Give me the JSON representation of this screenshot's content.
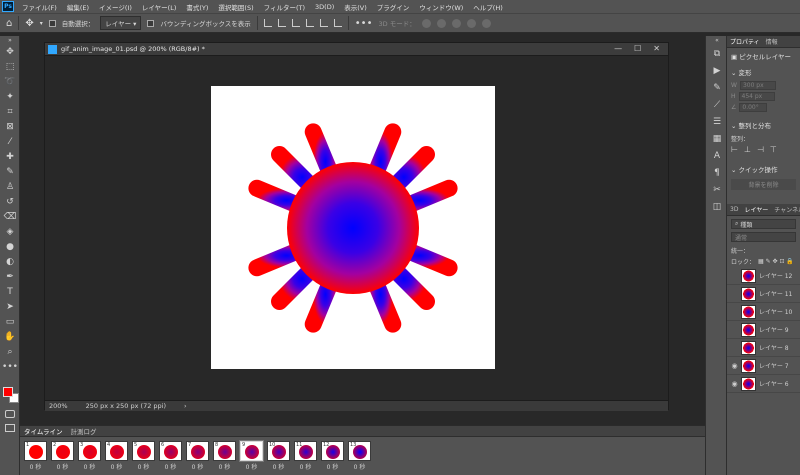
{
  "menubar": {
    "logo": "Ps",
    "items": [
      "ファイル(F)",
      "編集(E)",
      "イメージ(I)",
      "レイヤー(L)",
      "書式(Y)",
      "選択範囲(S)",
      "フィルター(T)",
      "3D(D)",
      "表示(V)",
      "プラグイン",
      "ウィンドウ(W)",
      "ヘルプ(H)"
    ]
  },
  "options": {
    "auto_select_label": "自動選択：",
    "auto_select_value": "レイヤー",
    "bbox_label": "バウンディングボックスを表示",
    "mode_3d_label": "3D モード："
  },
  "document": {
    "title": "gif_anim_image_01.psd @ 200% (RGB/8#) *",
    "zoom": "200%",
    "size_info": "250 px x 250 px (72 ppi)"
  },
  "timeline": {
    "tabs": [
      "タイムライン",
      "計測ログ"
    ],
    "frames": [
      {
        "num": "1",
        "delay": "0 秒"
      },
      {
        "num": "2",
        "delay": "0 秒"
      },
      {
        "num": "3",
        "delay": "0 秒"
      },
      {
        "num": "4",
        "delay": "0 秒"
      },
      {
        "num": "5",
        "delay": "0 秒"
      },
      {
        "num": "6",
        "delay": "0 秒"
      },
      {
        "num": "7",
        "delay": "0 秒"
      },
      {
        "num": "8",
        "delay": "0 秒"
      },
      {
        "num": "9",
        "delay": "0 秒"
      },
      {
        "num": "10",
        "delay": "0 秒"
      },
      {
        "num": "11",
        "delay": "0 秒"
      },
      {
        "num": "12",
        "delay": "0 秒"
      },
      {
        "num": "13",
        "delay": "0 秒"
      }
    ]
  },
  "properties": {
    "tabs": [
      "プロパティ",
      "情報"
    ],
    "layer_type": "ピクセルレイヤー",
    "transform_title": "変形",
    "w_label": "W",
    "w_value": "300 px",
    "h_label": "H",
    "h_value": "454 px",
    "angle_value": "0.00°",
    "align_title": "整列と分布",
    "align_label": "整列：",
    "quick_title": "クイック操作",
    "quick_button": "背景を削除"
  },
  "layers_panel": {
    "tabs": [
      "3D",
      "レイヤー",
      "チャンネル"
    ],
    "filter_label": "種類",
    "blend_mode": "通常",
    "unify_label": "統一：",
    "lock_label": "ロック：",
    "layers": [
      "レイヤー 12",
      "レイヤー 11",
      "レイヤー 10",
      "レイヤー 9",
      "レイヤー 8",
      "レイヤー 7",
      "レイヤー 6"
    ]
  },
  "colors": {
    "foreground": "#ff0000",
    "background": "#ffffff",
    "star_inner": "#0000ff",
    "star_outer": "#ff0000"
  }
}
